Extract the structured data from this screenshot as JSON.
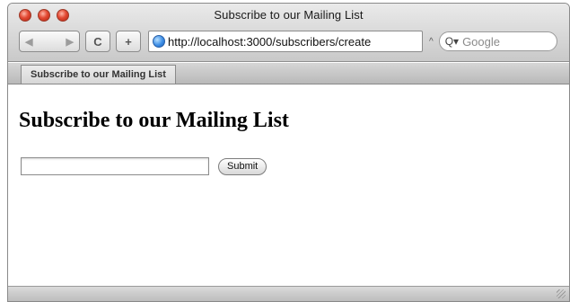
{
  "window": {
    "title": "Subscribe to our Mailing List",
    "traffic_light_color": "#e34a34"
  },
  "toolbar": {
    "back_icon": "back-icon",
    "forward_icon": "forward-icon",
    "back_glyph": "◀",
    "forward_glyph": "▶",
    "reload_icon": "reload-icon",
    "reload_glyph": "C",
    "add_bookmark_icon": "plus-icon",
    "add_bookmark_glyph": "+",
    "url": "http://localhost:3000/subscribers/create",
    "caret_glyph": "^",
    "search": {
      "magnifier_glyph": "Q▾",
      "placeholder": "Google"
    }
  },
  "tabs": [
    {
      "label": "Subscribe to our Mailing List"
    }
  ],
  "page": {
    "heading": "Subscribe to our Mailing List",
    "email_value": "",
    "submit_label": "Submit"
  }
}
